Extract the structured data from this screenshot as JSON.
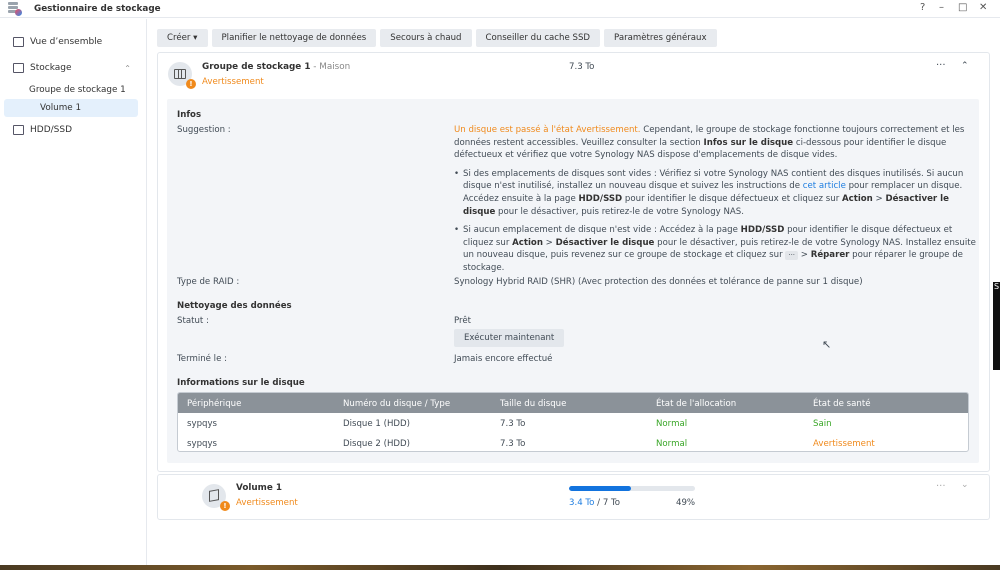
{
  "window": {
    "title": "Gestionnaire de stockage",
    "controls": [
      "?",
      "–",
      "□",
      "✕"
    ]
  },
  "sidebar": {
    "overview": "Vue d’ensemble",
    "storage": "Stockage",
    "pool": "Groupe de stockage 1",
    "volume": "Volume 1",
    "hdd": "HDD/SSD"
  },
  "toolbar": [
    "Créer ▾",
    "Planifier le nettoyage de données",
    "Secours à chaud",
    "Conseiller du cache SSD",
    "Paramètres généraux"
  ],
  "pool": {
    "title": "Groupe de stockage 1",
    "sep": " - ",
    "location": "Maison",
    "status": "Avertissement",
    "size": "7.3 To",
    "more": "···",
    "collapse": "⌃"
  },
  "info": {
    "heading": "Infos",
    "suggestion_label": "Suggestion :",
    "p1": [
      {
        "t": "Un disque est passé à l'état Avertissement.",
        "s": "o"
      },
      {
        "t": " Cependant, le groupe de stockage fonctionne toujours correctement et les données restent accessibles. Veuillez consulter la section ",
        "s": ""
      },
      {
        "t": "Infos sur le disque",
        "s": "b"
      },
      {
        "t": " ci-dessous pour identifier le disque défectueux et vérifiez que votre Synology NAS dispose d'emplacements de disque vides.",
        "s": ""
      }
    ],
    "b1": [
      {
        "t": "Si des emplacements de disques sont vides : Vérifiez si votre Synology NAS contient des disques inutilisés. Si aucun disque n'est inutilisé, installez un nouveau disque et suivez les instructions de ",
        "s": ""
      },
      {
        "t": "cet article",
        "s": "a"
      },
      {
        "t": " pour remplacer un disque. Accédez ensuite à la page ",
        "s": ""
      },
      {
        "t": "HDD/SSD",
        "s": "b"
      },
      {
        "t": " pour identifier le disque défectueux et cliquez sur ",
        "s": ""
      },
      {
        "t": "Action",
        "s": "b"
      },
      {
        "t": " > ",
        "s": ""
      },
      {
        "t": "Désactiver le disque",
        "s": "b"
      },
      {
        "t": " pour le désactiver, puis retirez-le de votre Synology NAS.",
        "s": ""
      }
    ],
    "b2": [
      {
        "t": "Si aucun emplacement de disque n'est vide : Accédez à la page ",
        "s": ""
      },
      {
        "t": "HDD/SSD",
        "s": "b"
      },
      {
        "t": " pour identifier le disque défectueux et cliquez sur ",
        "s": ""
      },
      {
        "t": "Action",
        "s": "b"
      },
      {
        "t": " > ",
        "s": ""
      },
      {
        "t": "Désactiver le disque",
        "s": "b"
      },
      {
        "t": " pour le désactiver, puis retirez-le de votre Synology NAS. Installez ensuite un nouveau disque, puis revenez sur ce groupe de stockage et cliquez sur ",
        "s": ""
      },
      {
        "t": "···",
        "s": "d"
      },
      {
        "t": " > ",
        "s": ""
      },
      {
        "t": "Réparer",
        "s": "b"
      },
      {
        "t": " pour réparer le groupe de stockage.",
        "s": ""
      }
    ],
    "raid_label": "Type de RAID :",
    "raid_value": "Synology Hybrid RAID (SHR) (Avec protection des données et tolérance de panne sur 1 disque)"
  },
  "scrub": {
    "heading": "Nettoyage des données",
    "status_label": "Statut :",
    "status_value": "Prêt",
    "run_button": "Exécuter maintenant",
    "done_label": "Terminé le :",
    "done_value": "Jamais encore effectué"
  },
  "disks": {
    "heading": "Informations sur le disque",
    "columns": [
      "Périphérique",
      "Numéro du disque / Type",
      "Taille du disque",
      "État de l'allocation",
      "État de santé"
    ],
    "rows": [
      [
        "sypqys",
        "Disque 1 (HDD)",
        "7.3 To",
        "Normal",
        "Sain"
      ],
      [
        "sypqys",
        "Disque 2 (HDD)",
        "7.3 To",
        "Normal",
        "Avertissement"
      ]
    ]
  },
  "volume": {
    "title": "Volume 1",
    "status": "Avertissement",
    "used": "3.4 To",
    "sep": " / ",
    "total": "7 To",
    "percent_label": "49%",
    "usage_fraction": 0.49,
    "more": "···",
    "expand": "⌄"
  },
  "edge_text": "S"
}
